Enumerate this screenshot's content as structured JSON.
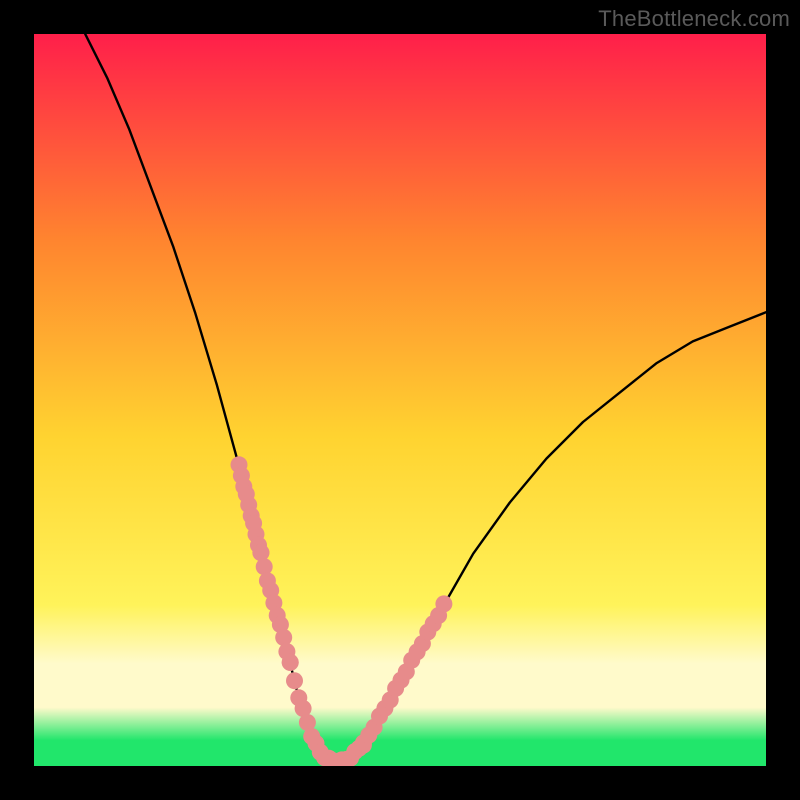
{
  "watermark": "TheBottleneck.com",
  "colors": {
    "frame": "#000000",
    "grad_top": "#ff1f4a",
    "grad_mid_upper": "#ff842f",
    "grad_mid": "#ffd330",
    "grad_mid_lower": "#fff35a",
    "grad_band": "#fffacb",
    "grad_bottom": "#21e66b",
    "curve": "#000000",
    "dots": "#e78b8b"
  },
  "chart_data": {
    "type": "line",
    "title": "",
    "xlabel": "",
    "ylabel": "",
    "xlim": [
      0,
      100
    ],
    "ylim": [
      0,
      100
    ],
    "grid": false,
    "legend": false,
    "series": [
      {
        "name": "bottleneck-curve",
        "x": [
          7,
          10,
          13,
          16,
          19,
          22,
          25,
          28,
          30,
          32,
          34,
          35,
          36,
          37,
          38,
          39,
          40,
          41.5,
          43,
          45,
          48,
          52,
          56,
          60,
          65,
          70,
          75,
          80,
          85,
          90,
          95,
          100
        ],
        "y": [
          100,
          94,
          87,
          79,
          71,
          62,
          52,
          41,
          33,
          25,
          18,
          14,
          10,
          7,
          4,
          2,
          1,
          0.5,
          1,
          3,
          8,
          15,
          22,
          29,
          36,
          42,
          47,
          51,
          55,
          58,
          60,
          62
        ]
      }
    ],
    "dot_clusters": [
      {
        "name": "left-upper-segment",
        "x_range": [
          28,
          31
        ],
        "y_range": [
          25,
          41
        ],
        "count": 10
      },
      {
        "name": "left-lower-segment",
        "x_range": [
          31,
          35
        ],
        "y_range": [
          12,
          25
        ],
        "count": 10
      },
      {
        "name": "valley-segment",
        "x_range": [
          35,
          45
        ],
        "y_range": [
          0,
          7
        ],
        "count": 18
      },
      {
        "name": "right-segment",
        "x_range": [
          45,
          56
        ],
        "y_range": [
          4,
          26
        ],
        "count": 16
      }
    ]
  }
}
